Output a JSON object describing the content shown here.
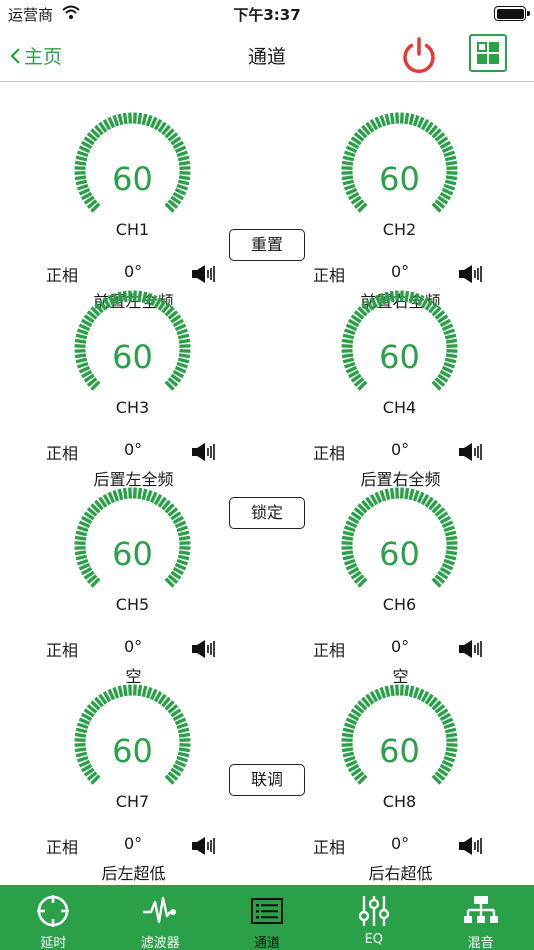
{
  "status_bar": {
    "carrier": "运营商",
    "time": "下午3:37"
  },
  "nav": {
    "back_label": "主页",
    "title": "通道"
  },
  "channels": [
    {
      "gauge_value": "60",
      "label": "CH1",
      "phase_label": "正相",
      "phase_value": "0°",
      "name": "前置左全频"
    },
    {
      "gauge_value": "60",
      "label": "CH2",
      "phase_label": "正相",
      "phase_value": "0°",
      "name": "前置右全频"
    },
    {
      "gauge_value": "60",
      "label": "CH3",
      "phase_label": "正相",
      "phase_value": "0°",
      "name": "后置左全频"
    },
    {
      "gauge_value": "60",
      "label": "CH4",
      "phase_label": "正相",
      "phase_value": "0°",
      "name": "后置右全频"
    },
    {
      "gauge_value": "60",
      "label": "CH5",
      "phase_label": "正相",
      "phase_value": "0°",
      "name": "空"
    },
    {
      "gauge_value": "60",
      "label": "CH6",
      "phase_label": "正相",
      "phase_value": "0°",
      "name": "空"
    },
    {
      "gauge_value": "60",
      "label": "CH7",
      "phase_label": "正相",
      "phase_value": "0°",
      "name": "后左超低"
    },
    {
      "gauge_value": "60",
      "label": "CH8",
      "phase_label": "正相",
      "phase_value": "0°",
      "name": "后右超低"
    }
  ],
  "buttons": {
    "reset": "重置",
    "lock": "锁定",
    "link": "联调"
  },
  "tabs": [
    {
      "label": "延时",
      "icon": "crosshair-icon"
    },
    {
      "label": "滤波器",
      "icon": "waveform-icon"
    },
    {
      "label": "通道",
      "icon": "list-icon"
    },
    {
      "label": "EQ",
      "icon": "sliders-icon"
    },
    {
      "label": "混音",
      "icon": "network-icon"
    }
  ],
  "colors": {
    "accent": "#2aa148",
    "power": "#e53935"
  }
}
